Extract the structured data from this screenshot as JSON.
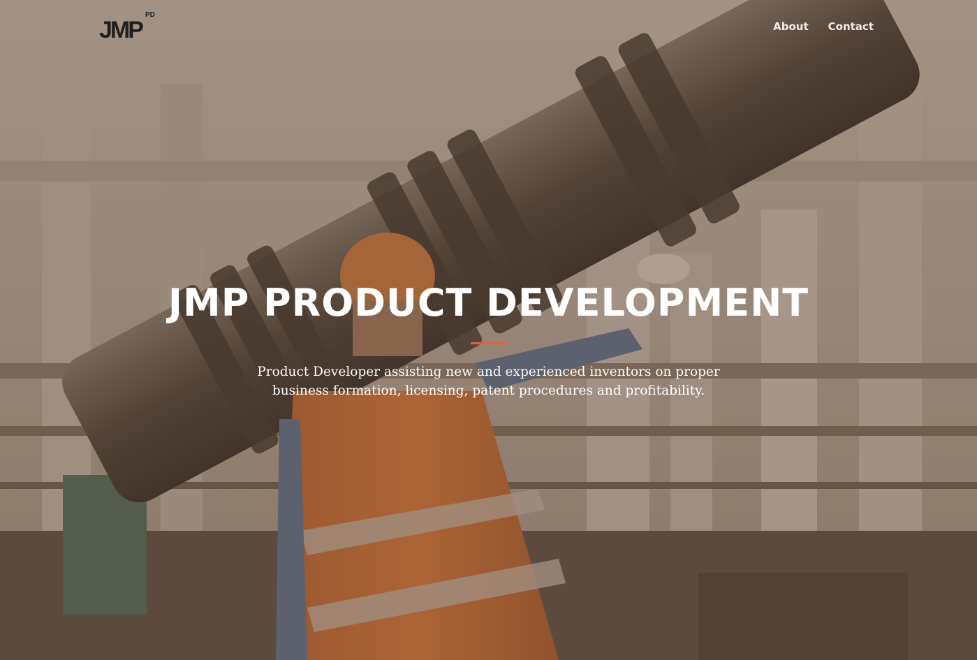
{
  "logo": {
    "text": "JMP",
    "superscript": "PD"
  },
  "nav": {
    "links": [
      "About",
      "Contact"
    ]
  },
  "hero": {
    "title": "JMP PRODUCT DEVELOPMENT",
    "subtitle": "Product Developer assisting new and experienced inventors on proper business formation, licensing, patent procedures and profitability."
  },
  "colors": {
    "overlay": "#5c4837",
    "divider": "#e06337",
    "nav_text": "#f2ebe4",
    "logo": "#1f1f1f"
  }
}
